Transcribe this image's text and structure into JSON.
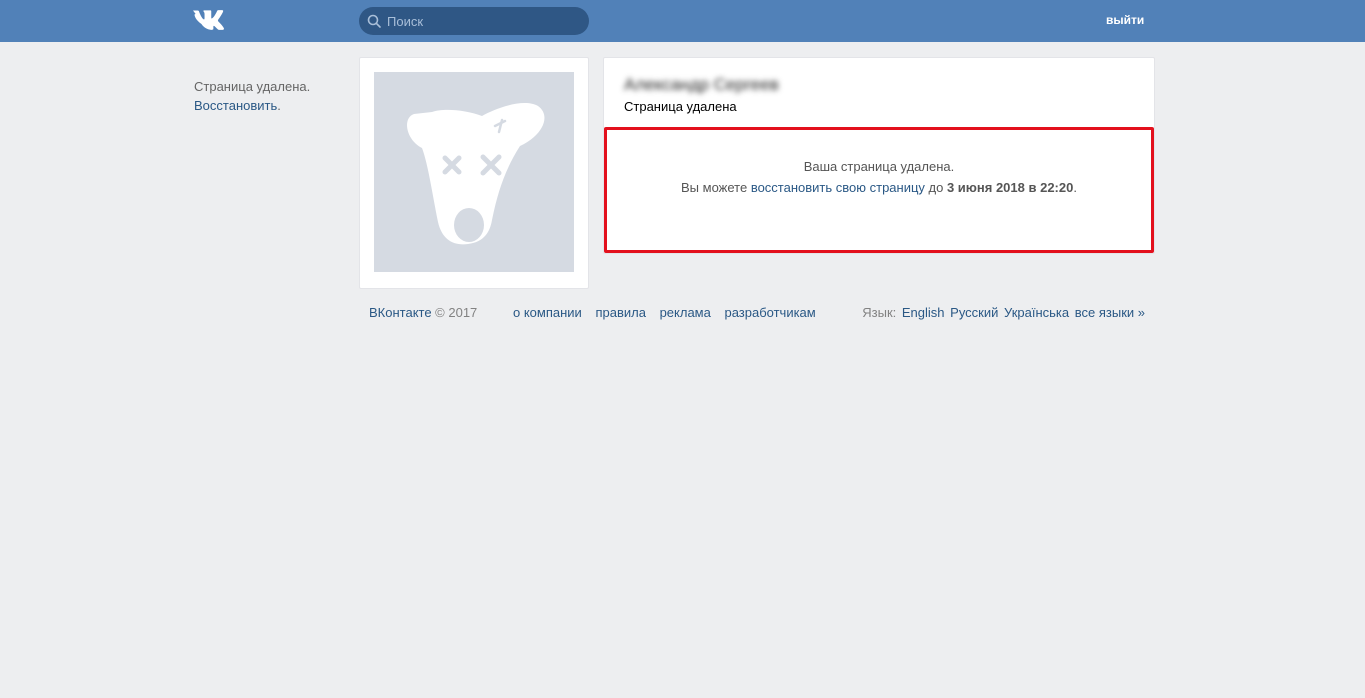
{
  "header": {
    "search_placeholder": "Поиск",
    "logout_label": "выйти"
  },
  "sidebar": {
    "status_text": "Страница удалена.",
    "restore_link": "Восстановить",
    "restore_suffix": "."
  },
  "profile": {
    "name_blurred": "Александр Сергеев",
    "status_text": "Страница удалена"
  },
  "notice": {
    "line1": "Ваша страница удалена.",
    "line2_prefix": "Вы можете ",
    "line2_link": "восстановить свою страницу",
    "line2_mid": " до ",
    "line2_date": "3 июня 2018 в 22:20",
    "line2_suffix": "."
  },
  "footer": {
    "brand": "ВКонтакте",
    "copyright": " © 2017",
    "links": [
      "о компании",
      "правила",
      "реклама",
      "разработчикам"
    ],
    "language_label": "Язык:",
    "languages": [
      "English",
      "Русский",
      "Українська",
      "все языки »"
    ]
  },
  "colors": {
    "header_bg": "#5181b8",
    "page_bg": "#edeef0",
    "link": "#2a5885",
    "highlight_border": "#e3101d"
  }
}
